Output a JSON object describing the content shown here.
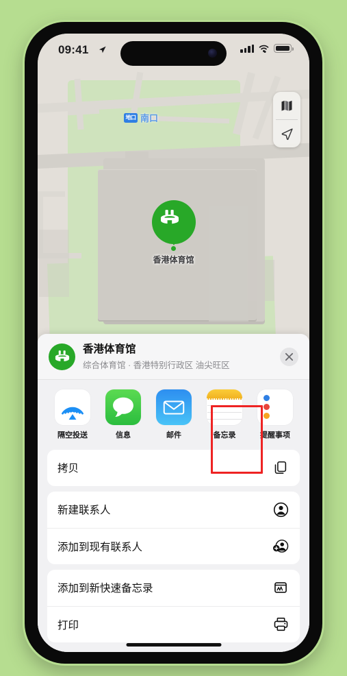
{
  "theme": {
    "background": "#b6dd90",
    "accent_green": "#28a828",
    "highlight_red": "#ee2323",
    "sheet_bg": "#f1f1f3",
    "transit_blue": "#2f7fe4"
  },
  "status_bar": {
    "time": "09:41",
    "location_arrow_icon": "location-arrow-icon",
    "signal_icon": "cellular-signal-icon",
    "wifi_icon": "wifi-icon",
    "battery_icon": "battery-full-icon"
  },
  "map": {
    "transit_badge": "地口",
    "transit_label": "南口",
    "pin_label": "香港体育馆",
    "pin_icon": "stadium-icon",
    "controls": [
      {
        "name": "map-layers-button",
        "icon": "map-layers-icon"
      },
      {
        "name": "current-location-button",
        "icon": "location-arrow-icon"
      }
    ]
  },
  "share_sheet": {
    "place": {
      "icon": "stadium-icon",
      "title": "香港体育馆",
      "subtitle": "综合体育馆 · 香港特别行政区 油尖旺区"
    },
    "close_label": "✕",
    "close_icon": "close-icon",
    "apps": [
      {
        "label": "隔空投送",
        "icon": "airdrop-icon",
        "highlighted": false
      },
      {
        "label": "信息",
        "icon": "messages-icon",
        "highlighted": false
      },
      {
        "label": "邮件",
        "icon": "mail-icon",
        "highlighted": false
      },
      {
        "label": "备忘录",
        "icon": "notes-icon",
        "highlighted": true
      },
      {
        "label": "提醒事项",
        "icon": "reminders-icon",
        "highlighted": false
      }
    ],
    "action_groups": [
      {
        "rows": [
          {
            "label": "拷贝",
            "icon": "copy-icon"
          }
        ]
      },
      {
        "rows": [
          {
            "label": "新建联系人",
            "icon": "person-circle-icon"
          },
          {
            "label": "添加到现有联系人",
            "icon": "person-add-icon"
          }
        ]
      },
      {
        "rows": [
          {
            "label": "添加到新快速备忘录",
            "icon": "quick-note-icon"
          },
          {
            "label": "打印",
            "icon": "printer-icon"
          }
        ]
      }
    ]
  }
}
